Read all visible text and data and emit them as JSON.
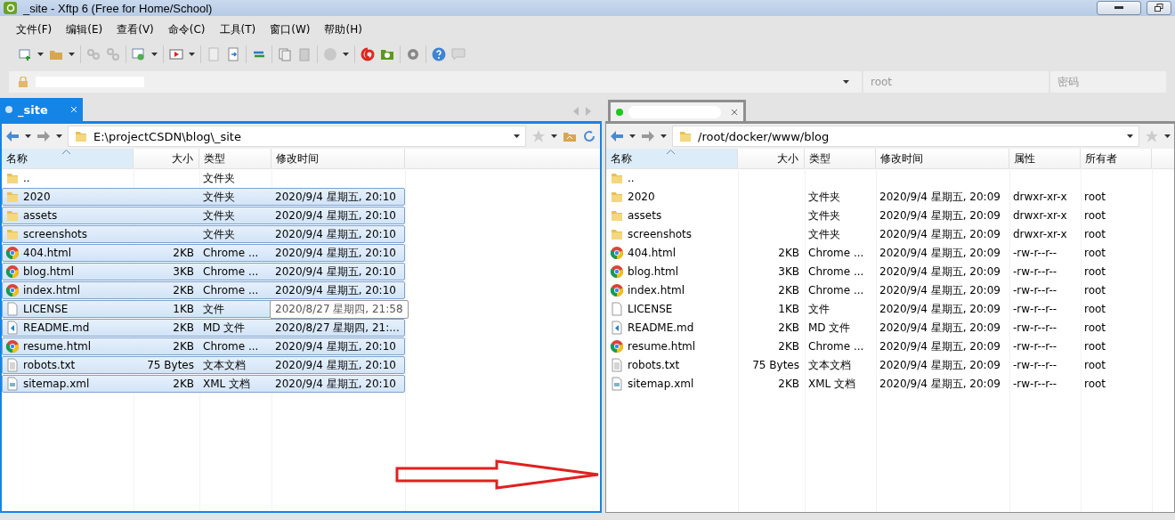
{
  "window": {
    "title": "_site - Xftp 6 (Free for Home/School)"
  },
  "menu": [
    "文件(F)",
    "编辑(E)",
    "查看(V)",
    "命令(C)",
    "工具(T)",
    "窗口(W)",
    "帮助(H)"
  ],
  "address_bar": {
    "user_placeholder": "root",
    "password_placeholder": "密码"
  },
  "panels": [
    {
      "focused": true,
      "tab": {
        "label": "_site",
        "selected": true,
        "connected": false
      },
      "path": "E:\\projectCSDN\\blog\\_site",
      "columns": [
        {
          "label": "名称",
          "sorted": true
        },
        {
          "label": "大小",
          "sorted": false
        },
        {
          "label": "类型",
          "sorted": false
        },
        {
          "label": "修改时间",
          "sorted": false
        }
      ],
      "rows": [
        {
          "kind": "folder",
          "selected": false,
          "tooltip": false,
          "cells": [
            "..",
            null,
            "文件夹",
            null
          ]
        },
        {
          "kind": "folder",
          "selected": true,
          "tooltip": false,
          "cells": [
            "2020",
            null,
            "文件夹",
            "2020/9/4 星期五, 20:10"
          ]
        },
        {
          "kind": "folder",
          "selected": true,
          "tooltip": false,
          "cells": [
            "assets",
            null,
            "文件夹",
            "2020/9/4 星期五, 20:10"
          ]
        },
        {
          "kind": "folder",
          "selected": true,
          "tooltip": false,
          "cells": [
            "screenshots",
            null,
            "文件夹",
            "2020/9/4 星期五, 20:10"
          ]
        },
        {
          "kind": "html",
          "selected": true,
          "tooltip": false,
          "cells": [
            "404.html",
            "2KB",
            "Chrome ...",
            "2020/9/4 星期五, 20:10"
          ]
        },
        {
          "kind": "html",
          "selected": true,
          "tooltip": false,
          "cells": [
            "blog.html",
            "3KB",
            "Chrome ...",
            "2020/9/4 星期五, 20:10"
          ]
        },
        {
          "kind": "html",
          "selected": true,
          "tooltip": false,
          "cells": [
            "index.html",
            "2KB",
            "Chrome ...",
            "2020/9/4 星期五, 20:10"
          ]
        },
        {
          "kind": "file",
          "selected": true,
          "tooltip": true,
          "cells": [
            "LICENSE",
            "1KB",
            "文件",
            "2020/8/27 星期四, 21:58"
          ]
        },
        {
          "kind": "md",
          "selected": true,
          "tooltip": false,
          "cells": [
            "README.md",
            "2KB",
            "MD 文件",
            "2020/8/27 星期四, 21:..."
          ]
        },
        {
          "kind": "html",
          "selected": true,
          "tooltip": false,
          "cells": [
            "resume.html",
            "2KB",
            "Chrome ...",
            "2020/9/4 星期五, 20:10"
          ]
        },
        {
          "kind": "txt",
          "selected": true,
          "tooltip": false,
          "cells": [
            "robots.txt",
            "75 Bytes",
            "文本文档",
            "2020/9/4 星期五, 20:10"
          ]
        },
        {
          "kind": "xml",
          "selected": true,
          "tooltip": false,
          "cells": [
            "sitemap.xml",
            "2KB",
            "XML 文档",
            "2020/9/4 星期五, 20:10"
          ]
        }
      ]
    },
    {
      "focused": false,
      "tab": {
        "selected": false,
        "connected": true
      },
      "path": "/root/docker/www/blog",
      "columns": [
        {
          "label": "名称",
          "sorted": true
        },
        {
          "label": "大小",
          "sorted": false
        },
        {
          "label": "类型",
          "sorted": false
        },
        {
          "label": "修改时间",
          "sorted": false
        },
        {
          "label": "属性",
          "sorted": false
        },
        {
          "label": "所有者",
          "sorted": false
        }
      ],
      "rows": [
        {
          "kind": "folder",
          "selected": false,
          "tooltip": false,
          "cells": [
            "..",
            null,
            null,
            null,
            null,
            null
          ]
        },
        {
          "kind": "folder",
          "selected": false,
          "tooltip": false,
          "cells": [
            "2020",
            null,
            "文件夹",
            "2020/9/4 星期五, 20:09",
            "drwxr-xr-x",
            "root"
          ]
        },
        {
          "kind": "folder",
          "selected": false,
          "tooltip": false,
          "cells": [
            "assets",
            null,
            "文件夹",
            "2020/9/4 星期五, 20:09",
            "drwxr-xr-x",
            "root"
          ]
        },
        {
          "kind": "folder",
          "selected": false,
          "tooltip": false,
          "cells": [
            "screenshots",
            null,
            "文件夹",
            "2020/9/4 星期五, 20:09",
            "drwxr-xr-x",
            "root"
          ]
        },
        {
          "kind": "html",
          "selected": false,
          "tooltip": false,
          "cells": [
            "404.html",
            "2KB",
            "Chrome ...",
            "2020/9/4 星期五, 20:09",
            "-rw-r--r--",
            "root"
          ]
        },
        {
          "kind": "html",
          "selected": false,
          "tooltip": false,
          "cells": [
            "blog.html",
            "3KB",
            "Chrome ...",
            "2020/9/4 星期五, 20:09",
            "-rw-r--r--",
            "root"
          ]
        },
        {
          "kind": "html",
          "selected": false,
          "tooltip": false,
          "cells": [
            "index.html",
            "2KB",
            "Chrome ...",
            "2020/9/4 星期五, 20:09",
            "-rw-r--r--",
            "root"
          ]
        },
        {
          "kind": "file",
          "selected": false,
          "tooltip": false,
          "cells": [
            "LICENSE",
            "1KB",
            "文件",
            "2020/9/4 星期五, 20:09",
            "-rw-r--r--",
            "root"
          ]
        },
        {
          "kind": "md",
          "selected": false,
          "tooltip": false,
          "cells": [
            "README.md",
            "2KB",
            "MD 文件",
            "2020/9/4 星期五, 20:09",
            "-rw-r--r--",
            "root"
          ]
        },
        {
          "kind": "html",
          "selected": false,
          "tooltip": false,
          "cells": [
            "resume.html",
            "2KB",
            "Chrome ...",
            "2020/9/4 星期五, 20:09",
            "-rw-r--r--",
            "root"
          ]
        },
        {
          "kind": "txt",
          "selected": false,
          "tooltip": false,
          "cells": [
            "robots.txt",
            "75 Bytes",
            "文本文档",
            "2020/9/4 星期五, 20:09",
            "-rw-r--r--",
            "root"
          ]
        },
        {
          "kind": "xml",
          "selected": false,
          "tooltip": false,
          "cells": [
            "sitemap.xml",
            "2KB",
            "XML 文档",
            "2020/9/4 星期五, 20:09",
            "-rw-r--r--",
            "root"
          ]
        }
      ]
    }
  ]
}
